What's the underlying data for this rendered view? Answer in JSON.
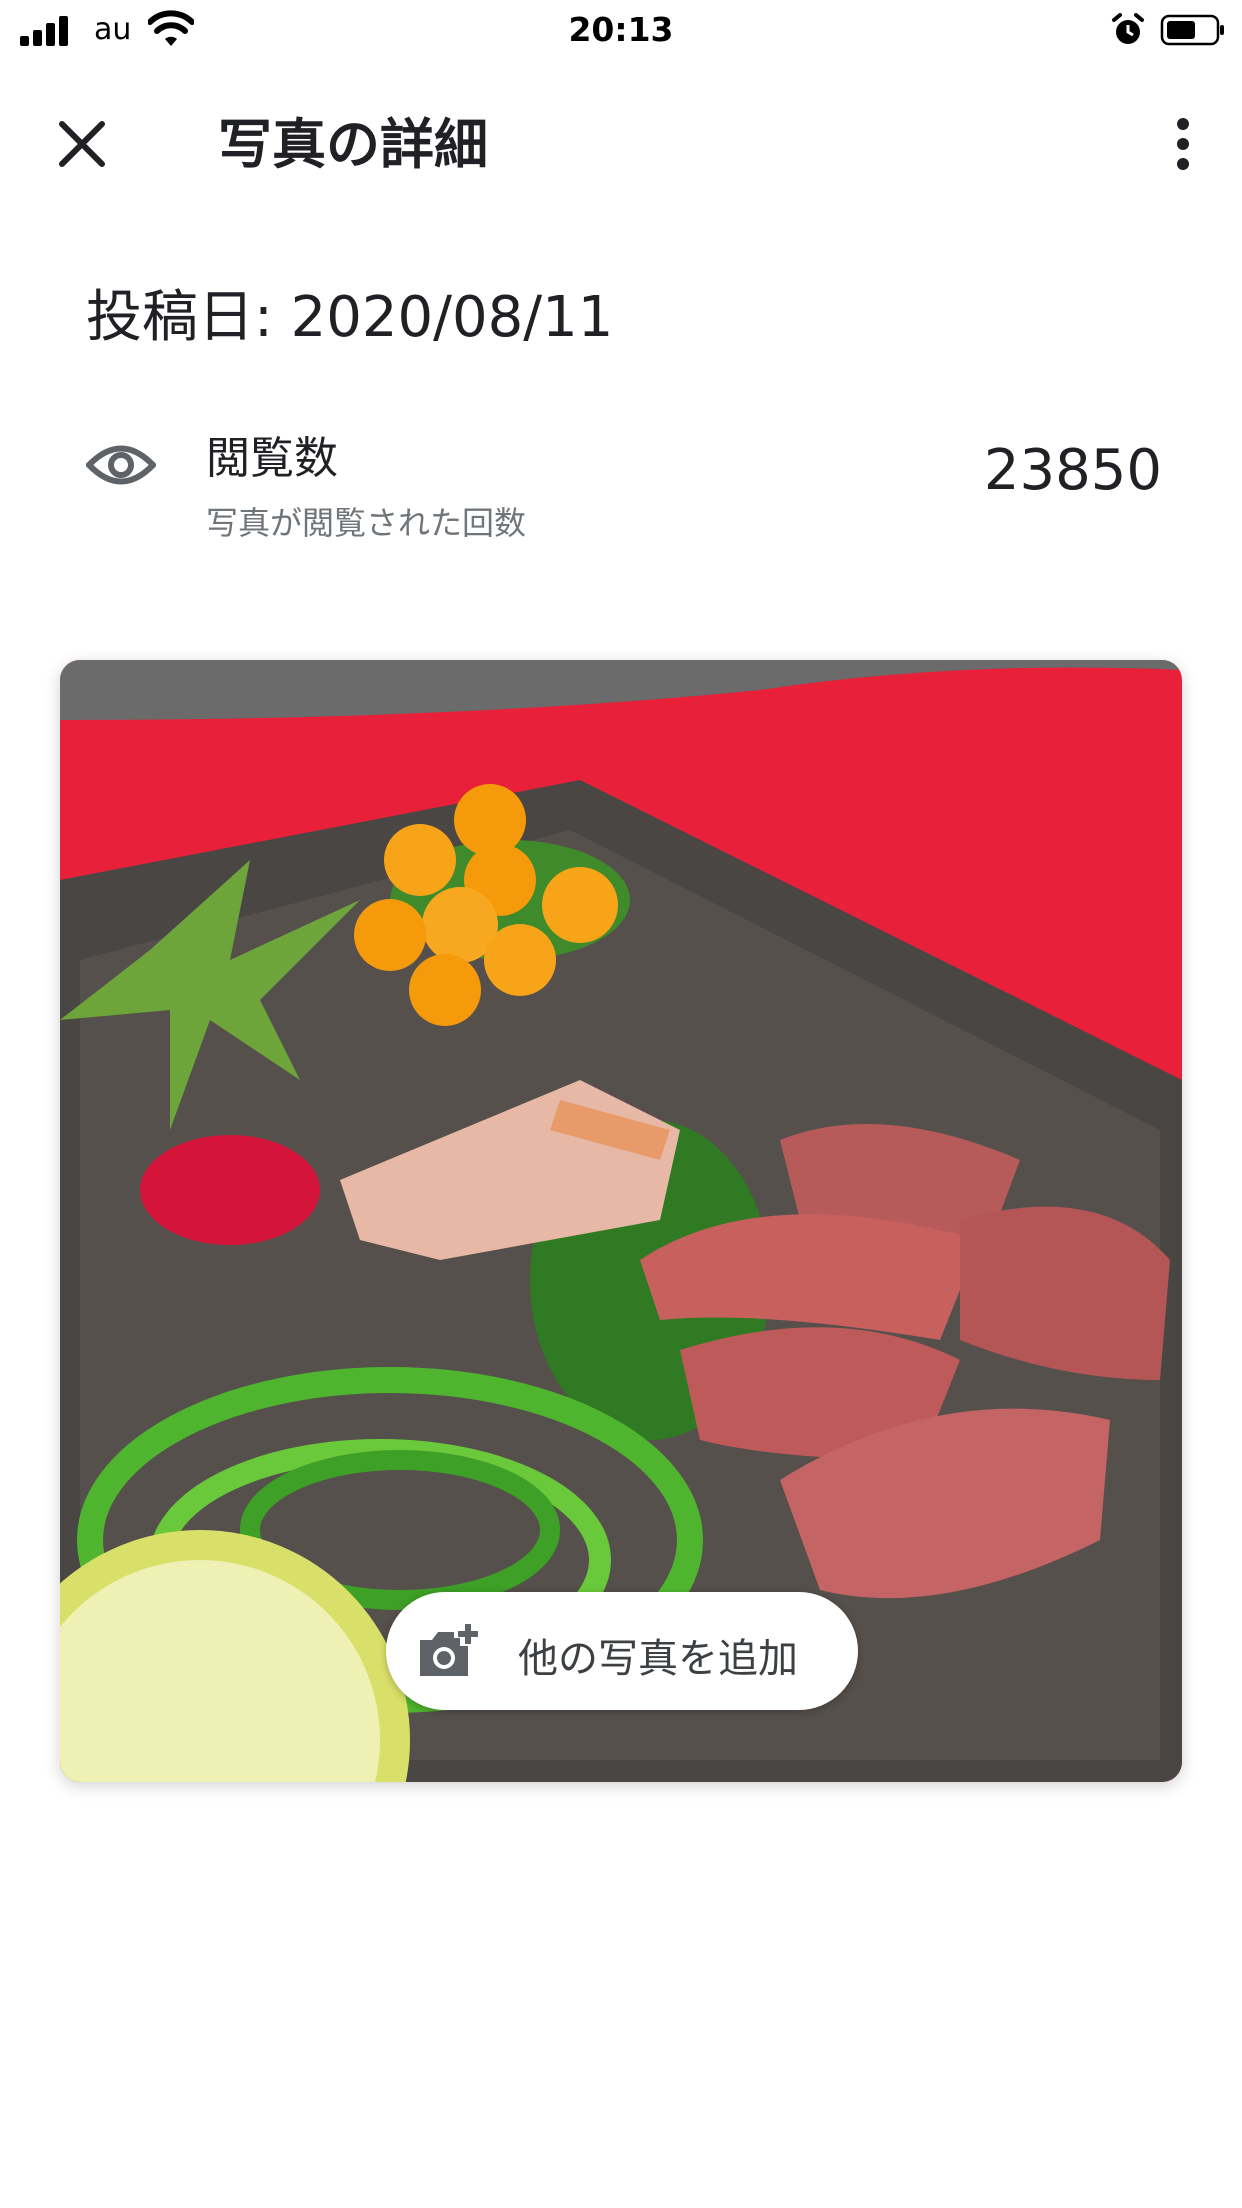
{
  "status_bar": {
    "carrier": "au",
    "time": "20:13",
    "icons": [
      "signal-icon",
      "wifi-icon",
      "alarm-icon",
      "battery-icon"
    ]
  },
  "app_bar": {
    "title": "写真の詳細",
    "close_icon": "close-icon",
    "more_icon": "more-vert-icon"
  },
  "post": {
    "posted_label": "投稿日: 2020/08/11"
  },
  "views": {
    "icon": "eye-icon",
    "title": "閲覧数",
    "subtitle": "写真が閲覧された回数",
    "count": "23850"
  },
  "photo": {
    "subject": "food plate photo"
  },
  "add_photo_button": {
    "icon": "add-photo-camera-icon",
    "label": "他の写真を追加"
  },
  "colors": {
    "accent_text": "#202124",
    "secondary_text": "#70757a",
    "icon_gray": "#5f6368"
  }
}
